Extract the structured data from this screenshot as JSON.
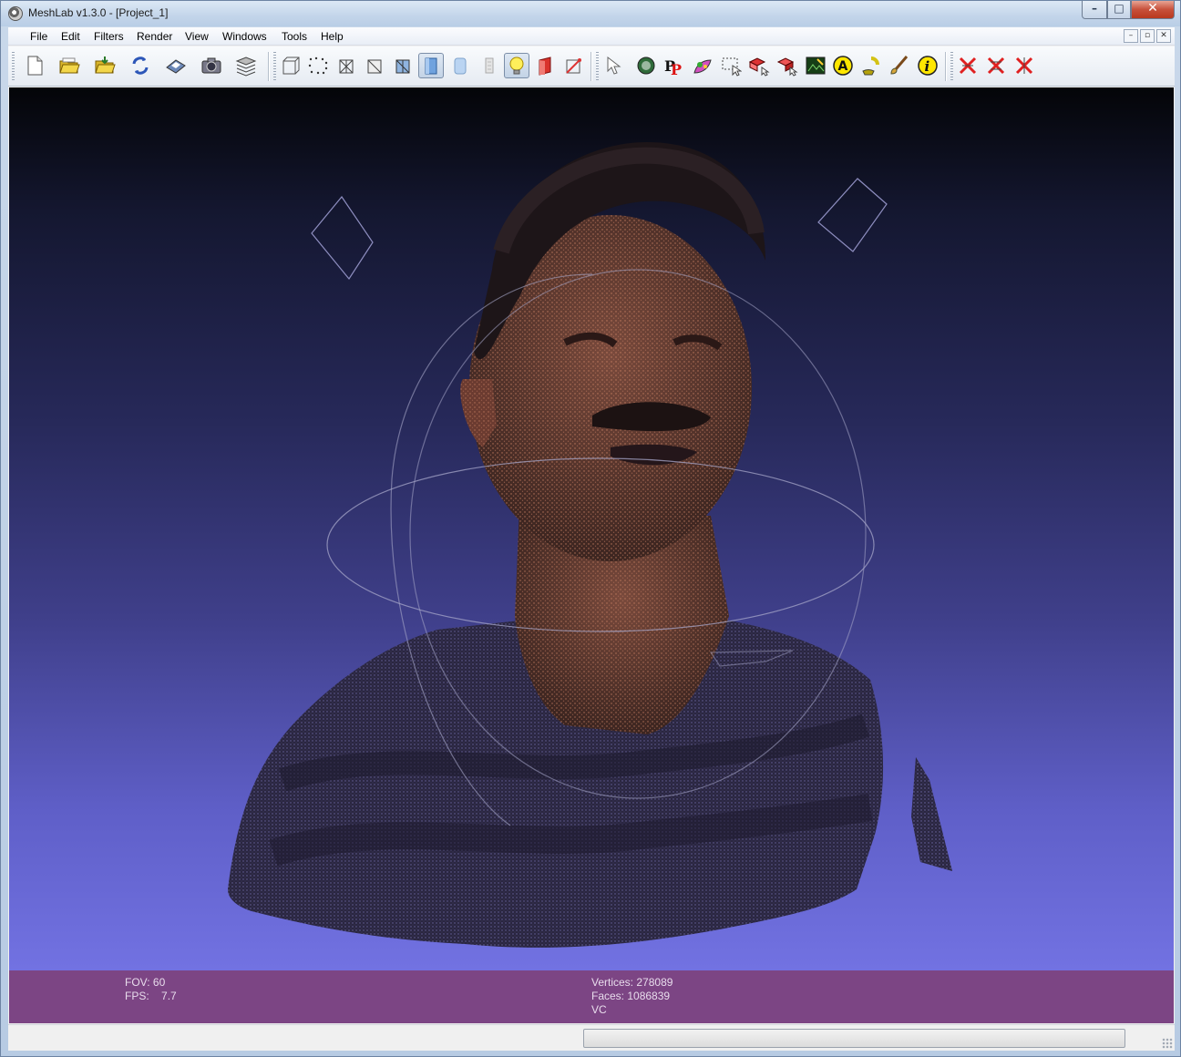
{
  "window": {
    "title": "MeshLab v1.3.0 - [Project_1]",
    "controls": {
      "minimize": "–",
      "maximize": "□",
      "close": "✕"
    }
  },
  "menubar": {
    "items": [
      "File",
      "Edit",
      "Filters",
      "Render",
      "View",
      "Windows",
      "Tools",
      "Help"
    ],
    "mdi_controls": [
      "–",
      "▫",
      "✕"
    ]
  },
  "toolbar": {
    "tools": [
      {
        "name": "new-document-icon"
      },
      {
        "name": "open-project-icon"
      },
      {
        "name": "import-mesh-icon"
      },
      {
        "name": "reload-icon"
      },
      {
        "name": "save-icon"
      },
      {
        "name": "snapshot-icon"
      },
      {
        "name": "layers-icon"
      },
      {
        "name": "bounding-box-icon"
      },
      {
        "name": "points-icon"
      },
      {
        "name": "wireframe-icon"
      },
      {
        "name": "hidden-lines-icon"
      },
      {
        "name": "flat-lines-icon"
      },
      {
        "name": "flat-icon",
        "active": true
      },
      {
        "name": "smooth-icon"
      },
      {
        "name": "texture-icon"
      },
      {
        "name": "light-icon",
        "active": true
      },
      {
        "name": "double-side-lighting-icon"
      },
      {
        "name": "backface-culling-icon"
      },
      {
        "name": "select-vertices-icon"
      },
      {
        "name": "quality-mapper-icon"
      },
      {
        "name": "pickpoints-icon"
      },
      {
        "name": "paint-icon"
      },
      {
        "name": "select-faces-icon"
      },
      {
        "name": "select-connected-icon"
      },
      {
        "name": "select-region-icon"
      },
      {
        "name": "raster-align-icon"
      },
      {
        "name": "measure-icon"
      },
      {
        "name": "align-icon"
      },
      {
        "name": "brush-icon"
      },
      {
        "name": "info-icon"
      },
      {
        "name": "delete-vertices-icon"
      },
      {
        "name": "delete-faces-icon"
      },
      {
        "name": "delete-faces-vertices-icon"
      }
    ]
  },
  "info": {
    "fov_label": "FOV:",
    "fov_value": "60",
    "fps_label": "FPS:",
    "fps_value": "7.7",
    "vertices_label": "Vertices:",
    "vertices_value": "278089",
    "faces_label": "Faces:",
    "faces_value": "1086839",
    "mode": "VC"
  },
  "colors": {
    "info_bar": "#7c4584",
    "background_top": "#040508",
    "background_bottom": "#7272e2"
  }
}
